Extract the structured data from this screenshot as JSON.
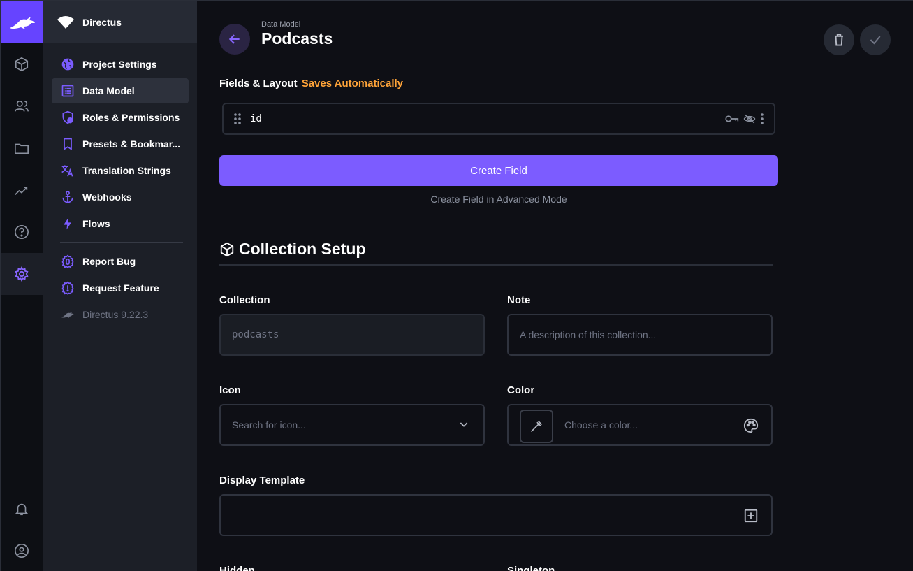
{
  "project": {
    "name": "Directus"
  },
  "nav": {
    "items": [
      {
        "label": "Project Settings"
      },
      {
        "label": "Data Model"
      },
      {
        "label": "Roles & Permissions"
      },
      {
        "label": "Presets & Bookmar..."
      },
      {
        "label": "Translation Strings"
      },
      {
        "label": "Webhooks"
      },
      {
        "label": "Flows"
      }
    ],
    "extra": [
      {
        "label": "Report Bug"
      },
      {
        "label": "Request Feature"
      },
      {
        "label": "Directus 9.22.3"
      }
    ]
  },
  "header": {
    "breadcrumb": "Data Model",
    "title": "Podcasts"
  },
  "fields": {
    "section_title": "Fields & Layout",
    "autosave": "Saves Automatically",
    "rows": [
      {
        "name": "id"
      }
    ],
    "create_button": "Create Field",
    "advanced_link": "Create Field in Advanced Mode"
  },
  "setup": {
    "title": "Collection Setup",
    "collection": {
      "label": "Collection",
      "value": "podcasts"
    },
    "note": {
      "label": "Note",
      "placeholder": "A description of this collection..."
    },
    "icon": {
      "label": "Icon",
      "placeholder": "Search for icon..."
    },
    "color": {
      "label": "Color",
      "placeholder": "Choose a color..."
    },
    "display_template": {
      "label": "Display Template"
    },
    "hidden": {
      "label": "Hidden"
    },
    "singleton": {
      "label": "Singleton"
    }
  },
  "colors": {
    "accent": "#6644ff",
    "warning": "#ffa439",
    "background": "#0e0f15",
    "nav": "#1c1f27"
  }
}
